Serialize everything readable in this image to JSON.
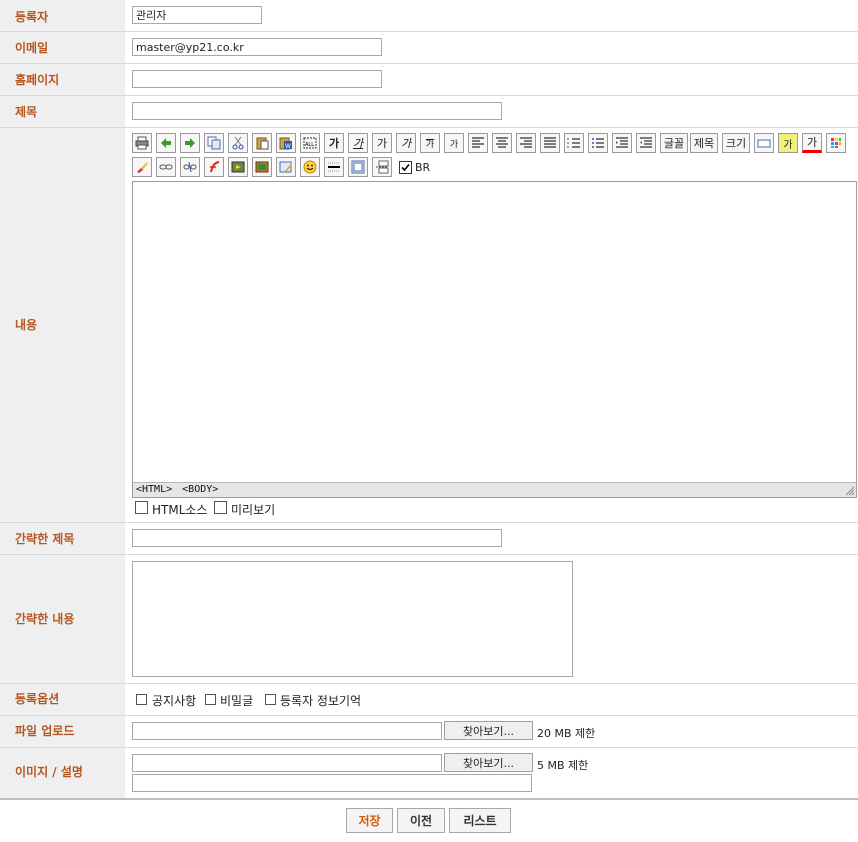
{
  "fields": {
    "author": {
      "label": "등록자",
      "value": "관리자"
    },
    "email": {
      "label": "이메일",
      "value": "master@yp21.co.kr"
    },
    "homepage": {
      "label": "홈페이지",
      "value": ""
    },
    "subject": {
      "label": "제목",
      "value": ""
    },
    "content": {
      "label": "내용"
    },
    "short_subject": {
      "label": "간략한 제목",
      "value": ""
    },
    "short_content": {
      "label": "간략한 내용",
      "value": ""
    },
    "options": {
      "label": "등록옵션",
      "notice": "공지사항",
      "secret": "비밀글",
      "remember": "등록자 정보기억"
    },
    "file_upload": {
      "label": "파일 업로드",
      "browse": "찾아보기...",
      "limit": "20 MB 제한"
    },
    "image": {
      "label": "이미지 / 설명",
      "browse": "찾아보기...",
      "limit": "5 MB 제한"
    }
  },
  "editor": {
    "toolbar_text": {
      "bold": "가",
      "italic": "가",
      "underline": "가",
      "strike": "가",
      "sup": "가",
      "sub": "가",
      "font": "글꼴",
      "heading": "제목",
      "size": "크기",
      "fgcolor": "가",
      "bgcolor": "가"
    },
    "br_label": "BR",
    "status_html": "<HTML>",
    "status_body": "<BODY>",
    "html_source": "HTML소스",
    "preview": "미리보기"
  },
  "buttons": {
    "save": "저장",
    "prev": "이전",
    "list": "리스트"
  }
}
